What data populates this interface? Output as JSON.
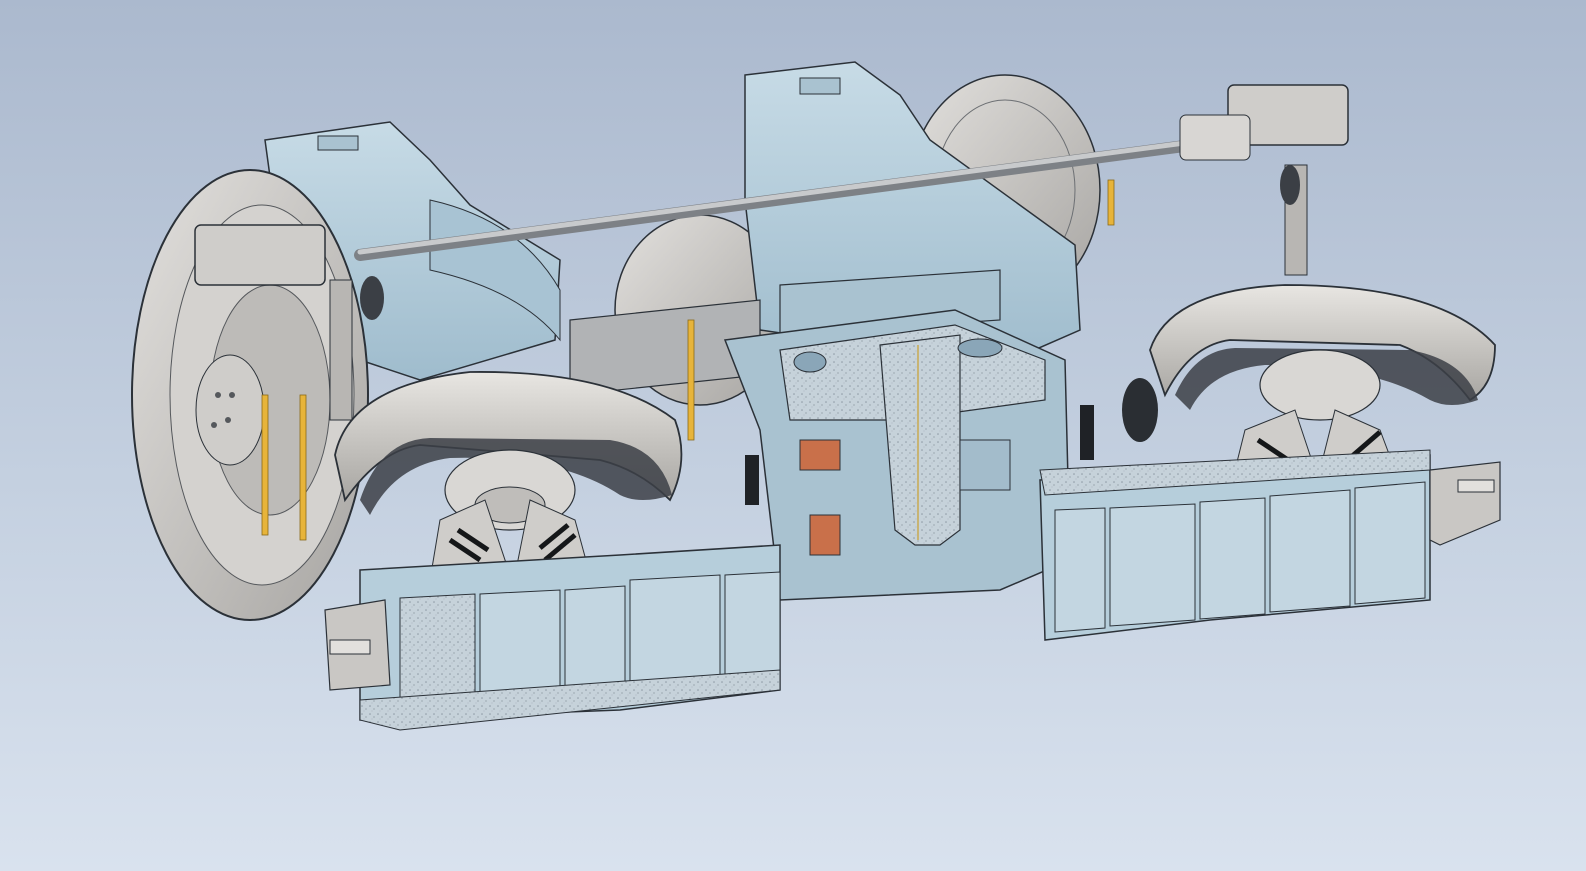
{
  "app": {
    "view": "cad-3d-viewport",
    "model": "bogie-section-view"
  },
  "colors": {
    "background_top": "#abb9ce",
    "background_bottom": "#d9e2ee",
    "frame_blue": "#b9d0dd",
    "frame_blue_dark": "#8fb0c4",
    "section_fill": "#c9d4dc",
    "wheel_grey": "#c8c6c3",
    "metal_dark": "#8c8f94",
    "accent_yellow": "#e7b43a",
    "accent_orange": "#c9704a",
    "edge": "#2b3138"
  }
}
